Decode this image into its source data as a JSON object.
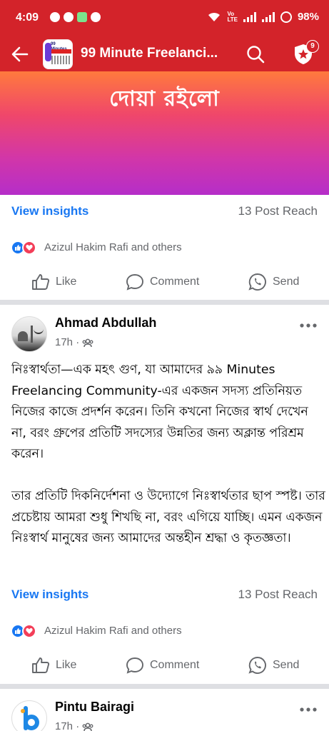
{
  "status_bar": {
    "time": "4:09",
    "volte": "Vo\nLTE",
    "network": "LTE1",
    "battery": "98%"
  },
  "app_bar": {
    "title": "99 Minute Freelanci...",
    "group_logo_text": "99 Minutes Freelancing Community",
    "notification_count": "9"
  },
  "banner": {
    "text": "দোয়া রইলো"
  },
  "post1_footer": {
    "view_insights": "View insights",
    "post_reach": "13 Post Reach",
    "reactions_text": "Azizul Hakim Rafi and others",
    "like_label": "Like",
    "comment_label": "Comment",
    "send_label": "Send"
  },
  "post2": {
    "author": "Ahmad Abdullah",
    "time": "17h ·",
    "paragraphs": [
      "নিঃস্বার্থতা—এক মহৎ গুণ, যা আমাদের ৯৯ Minutes Freelancing Community-এর একজন সদস্য প্রতিনিয়ত নিজের কাজে প্রদর্শন করেন। তিনি কখনো নিজের স্বার্থ দেখেন না, বরং গ্রুপের প্রতিটি সদস্যের উন্নতির জন্য অক্লান্ত পরিশ্রম করেন।",
      "তার প্রতিটি দিকনির্দেশনা ও উদ্যোগে নিঃস্বার্থতার ছাপ স্পষ্ট। তার প্রচেষ্টায় আমরা শুধু শিখছি না, বরং এগিয়ে যাচ্ছি। এমন একজন নিঃস্বার্থ মানুষের জন্য আমাদের অন্তহীন শ্রদ্ধা ও কৃতজ্ঞতা।"
    ],
    "view_insights": "View insights",
    "post_reach": "13 Post Reach",
    "reactions_text": "Azizul Hakim Rafi and others",
    "like_label": "Like",
    "comment_label": "Comment",
    "send_label": "Send"
  },
  "post3": {
    "author": "Pintu Bairagi",
    "time": "17h ·"
  },
  "colors": {
    "brand_red": "#d3232a",
    "link_blue": "#1877f2",
    "muted": "#65676b"
  }
}
